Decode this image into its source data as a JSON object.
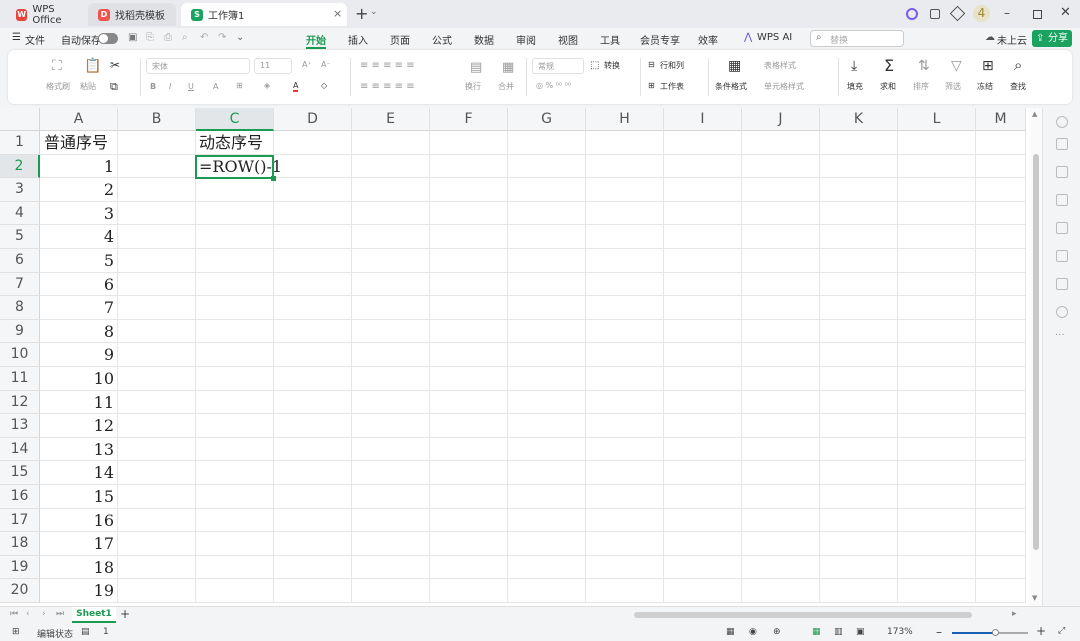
{
  "titlebar": {
    "tabs": [
      {
        "label": "WPS Office",
        "icon": "wps-logo-icon",
        "color": "#e8453c"
      },
      {
        "label": "找稻壳模板",
        "icon": "docer-icon",
        "color": "#f0544f"
      },
      {
        "label": "工作簿1",
        "icon": "spreadsheet-icon",
        "color": "#1aa260",
        "active": true
      }
    ],
    "new_tab": "+",
    "badge": "4"
  },
  "menubar": {
    "file": "文件",
    "autosave": "自动保存",
    "tabs": [
      "开始",
      "插入",
      "页面",
      "公式",
      "数据",
      "审阅",
      "视图",
      "工具",
      "会员专享",
      "效率"
    ],
    "active_tab": "开始",
    "ai": "WPS AI",
    "search_placeholder": "替换",
    "cloud": "未上云",
    "share": "分享"
  },
  "ribbon": {
    "format_painter": "格式刷",
    "paste": "粘贴",
    "font_name": "宋体",
    "font_size": "11",
    "wrap": "换行",
    "merge": "合并",
    "number_format": "常规",
    "convert": "转换",
    "rows_cols": "行和列",
    "worksheet": "工作表",
    "cond_format": "条件格式",
    "table_style": "表格样式",
    "cell_style": "单元格样式",
    "fill": "填充",
    "sum": "求和",
    "sort": "排序",
    "filter": "筛选",
    "freeze": "冻结",
    "find": "查找"
  },
  "grid": {
    "columns": [
      "A",
      "B",
      "C",
      "D",
      "E",
      "F",
      "G",
      "H",
      "I",
      "J",
      "K",
      "L",
      "M"
    ],
    "active_column": "C",
    "active_row": "2",
    "rows": [
      "1",
      "2",
      "3",
      "4",
      "5",
      "6",
      "7",
      "8",
      "9",
      "10",
      "11",
      "12",
      "13",
      "14",
      "15",
      "16",
      "17",
      "18",
      "19",
      "20"
    ],
    "A": [
      "普通序号",
      "1",
      "2",
      "3",
      "4",
      "5",
      "6",
      "7",
      "8",
      "9",
      "10",
      "11",
      "12",
      "13",
      "14",
      "15",
      "16",
      "17",
      "18",
      "19"
    ],
    "C1": "动态序号",
    "C2": "=ROW()-1"
  },
  "sheetbar": {
    "sheet": "Sheet1",
    "add": "+"
  },
  "statusbar": {
    "mode": "编辑状态",
    "count": "1",
    "zoom": "173%"
  },
  "colors": {
    "accent": "#1aa260",
    "active_tab_text": "#1a9a52",
    "share_bg": "#1aa260"
  }
}
